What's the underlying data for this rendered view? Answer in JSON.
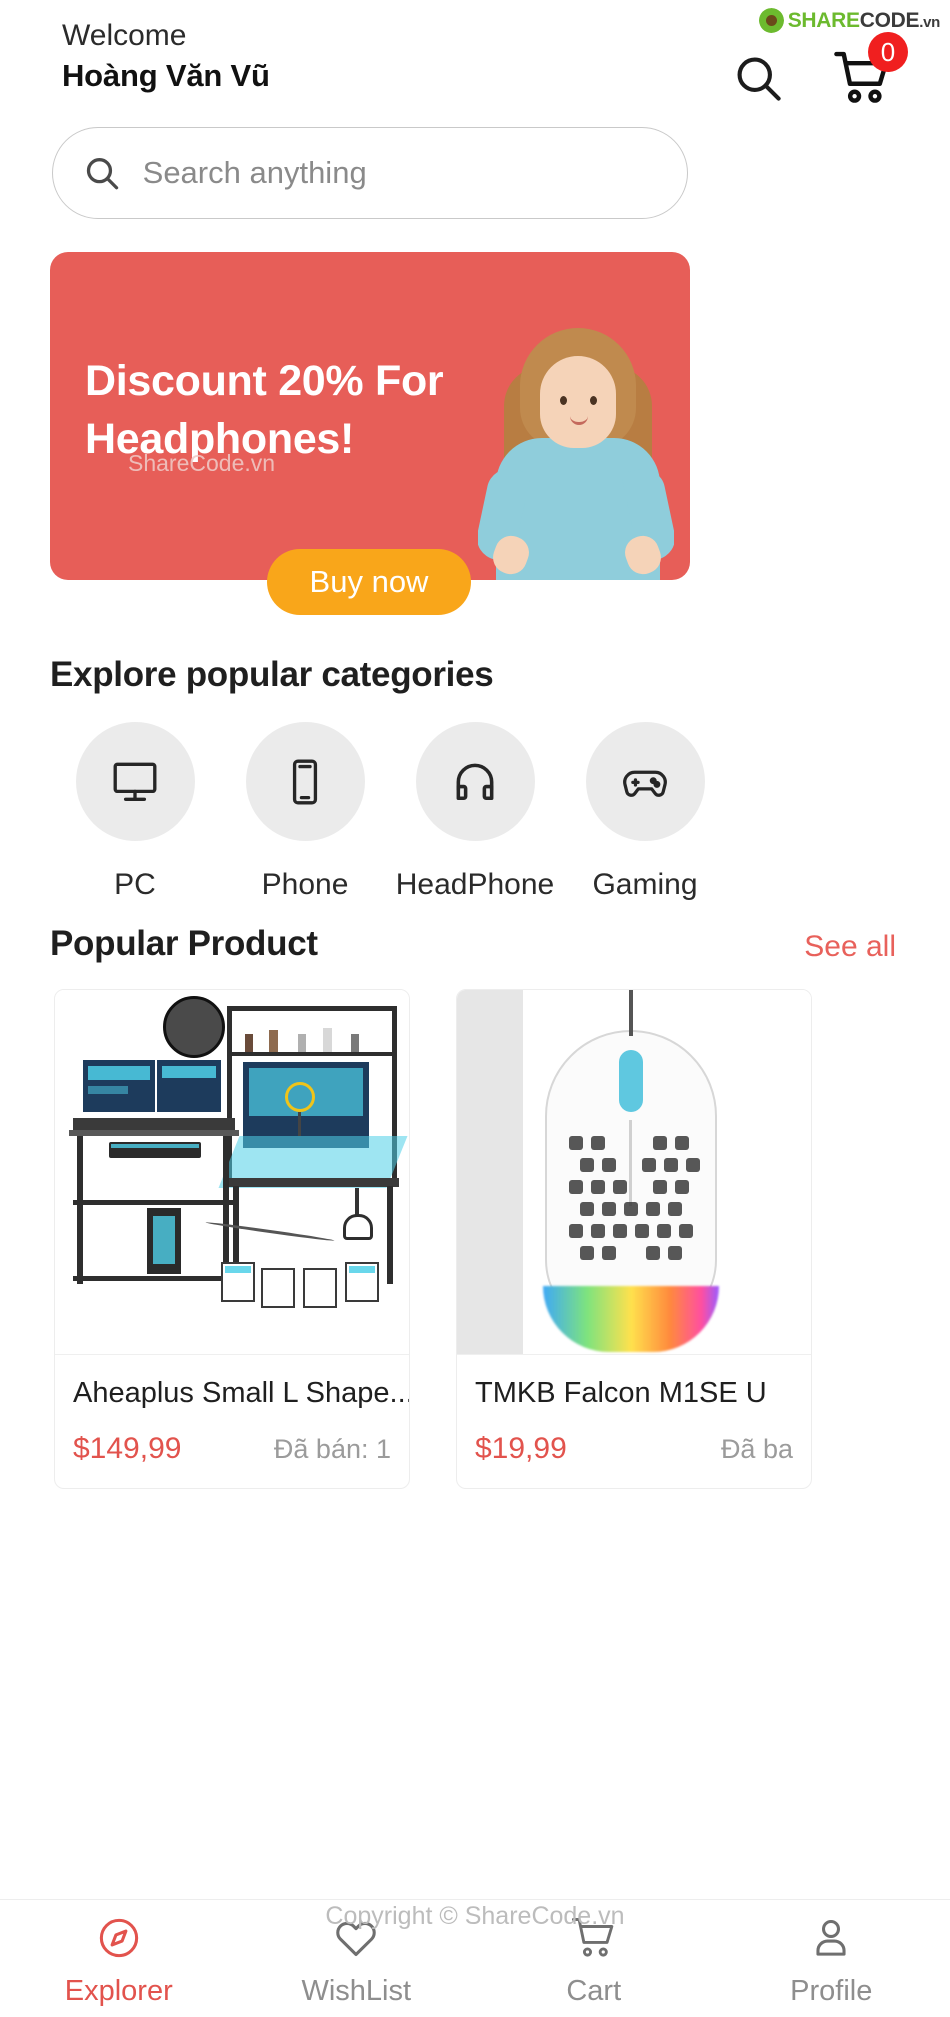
{
  "brand": {
    "logo_green": "SHARE",
    "logo_dark": "CODE",
    "logo_tld": ".vn"
  },
  "header": {
    "welcome_label": "Welcome",
    "username": "Hoàng Văn Vũ",
    "search_icon": "search-icon",
    "cart_icon": "cart-icon",
    "cart_count": "0"
  },
  "search": {
    "placeholder": "Search anything",
    "value": "",
    "icon": "search-icon"
  },
  "banner": {
    "title": "Discount 20% For Headphones!",
    "cta_label": "Buy now",
    "watermark": "ShareCode.vn",
    "bg_color": "#e75e58",
    "cta_color": "#f9a61a"
  },
  "categories": {
    "title": "Explore popular categories",
    "items": [
      {
        "label": "PC",
        "icon": "monitor-icon"
      },
      {
        "label": "Phone",
        "icon": "smartphone-icon"
      },
      {
        "label": "HeadPhone",
        "icon": "headphones-icon"
      },
      {
        "label": "Gaming",
        "icon": "gamepad-icon"
      }
    ]
  },
  "popular": {
    "title": "Popular Product",
    "see_all_label": "See all",
    "see_all_color": "#e8615b",
    "products": [
      {
        "name": "Aheaplus Small L Shape...",
        "price": "$149,99",
        "sold": "Đã bán: 1",
        "image": "gaming-desk-setup"
      },
      {
        "name": "TMKB Falcon M1SE U",
        "price": "$19,99",
        "sold": "Đã ba",
        "image": "white-gaming-mouse"
      }
    ]
  },
  "footer_watermark": "Copyright © ShareCode.vn",
  "bottom_nav": {
    "items": [
      {
        "label": "Explorer",
        "icon": "compass-icon",
        "active": true
      },
      {
        "label": "WishList",
        "icon": "heart-icon",
        "active": false
      },
      {
        "label": "Cart",
        "icon": "cart-icon",
        "active": false
      },
      {
        "label": "Profile",
        "icon": "user-icon",
        "active": false
      }
    ]
  }
}
